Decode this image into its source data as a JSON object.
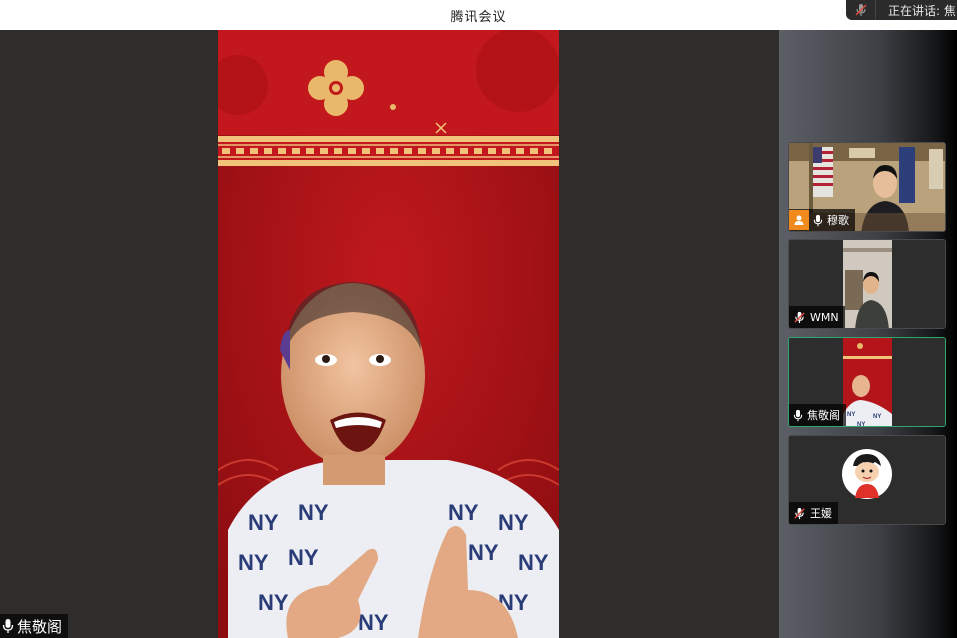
{
  "window": {
    "title": "腾讯会议"
  },
  "speaking_indicator": {
    "text": "正在讲话: 焦"
  },
  "main_video": {
    "participant_name": "焦敬阁",
    "mic_state": "on"
  },
  "participants": [
    {
      "name": "穆歌",
      "mic_state": "on",
      "is_host": true,
      "active": false,
      "video_scene": "office-flags"
    },
    {
      "name": "WMN",
      "mic_state": "off",
      "is_host": false,
      "active": false,
      "video_scene": "bunk-room"
    },
    {
      "name": "焦敬阁",
      "mic_state": "on",
      "is_host": false,
      "active": true,
      "video_scene": "red-new-year"
    },
    {
      "name": "王媛",
      "mic_state": "off",
      "is_host": false,
      "active": false,
      "video_scene": "avatar-cartoon"
    }
  ],
  "colors": {
    "active_border": "#2ea86c",
    "host_badge": "#f08a1c",
    "stage_bg": "#2f2d2c"
  }
}
